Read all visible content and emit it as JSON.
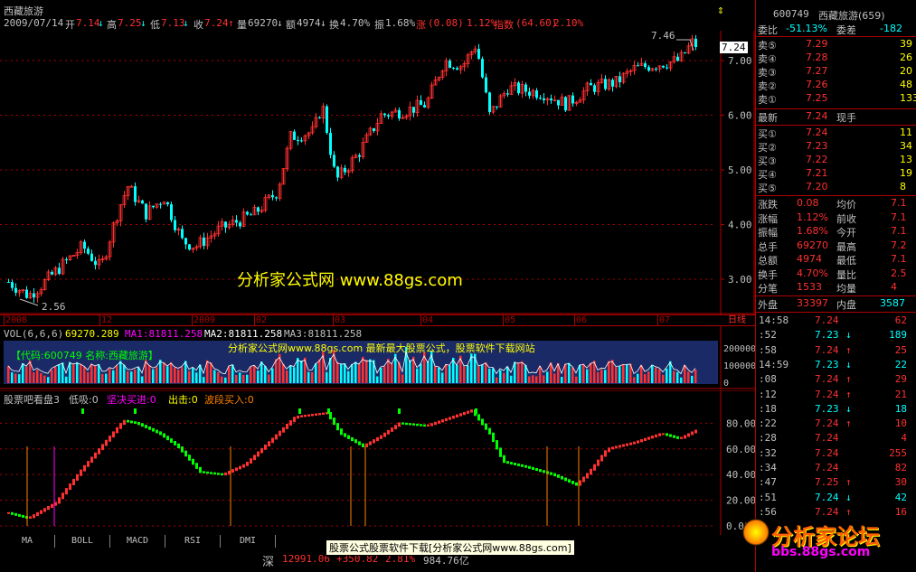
{
  "header": {
    "stock_name": "西藏旅游",
    "date": "2009/07/14",
    "open_label": "开",
    "open": "7.14",
    "high_label": "高",
    "high": "7.25",
    "low_label": "低",
    "low": "7.13",
    "close_label": "收",
    "close": "7.24",
    "volume_label": "量",
    "volume": "69270",
    "amount_label": "额",
    "amount": "4974",
    "turnover_label": "换",
    "turnover": "4.70%",
    "amplitude_label": "振",
    "amplitude": "1.68%",
    "change_label": "涨",
    "change": "(0.08)",
    "change_pct": "1.12%",
    "index_label": "指数",
    "index_val": "(64.60)",
    "index_pct": "2.10%"
  },
  "price_chart": {
    "high_marker": "7.46",
    "low_marker": "2.56",
    "current_price_tag": "7.24",
    "y_ticks": [
      "7.00",
      "6.00",
      "5.00",
      "4.00",
      "3.00"
    ],
    "x_labels": [
      "2008",
      "12",
      "2009",
      "02",
      "03",
      "04",
      "05",
      "06",
      "07",
      "日线"
    ],
    "watermark": "分析家公式网  www.88gs.com"
  },
  "volume_chart": {
    "legend_vol": "VOL(6,6,6)",
    "vol_val": "69270.289",
    "legend_ma1": "MA1:81811.258",
    "legend_ma2": "MA2:81811.258",
    "legend_ma3": "MA3:81811.258",
    "banner": "分析家公式网www.88gs.com 最新最大股票公式，股票软件下载网站",
    "code_box": "【代码:600749  名称:西藏旅游】",
    "y_ticks": [
      "200000",
      "100000",
      "0"
    ]
  },
  "indicator_chart": {
    "name": "股票吧看盘3",
    "low_buy": "低吸:0",
    "firm_buy": "坚决买进:0",
    "strike": "出击:0",
    "wave_buy": "波段买入:0",
    "y_ticks": [
      "80.00",
      "60.00",
      "40.00",
      "20.00",
      "0.00"
    ]
  },
  "tabs": [
    "MA",
    "BOLL",
    "MACD",
    "RSI",
    "DMI"
  ],
  "status": {
    "market": "深",
    "index_value": "12991.06",
    "index_change": "+350.82",
    "index_pct": "2.81%",
    "index_amount": "984.76亿",
    "tooltip": "股票公式股票软件下载[分析家公式网www.88gs.com]"
  },
  "quote_panel": {
    "code": "600749",
    "name": "西藏旅游(659)",
    "wei_bi_label": "委比",
    "wei_bi": "-51.13%",
    "wei_cha_label": "委差",
    "wei_cha": "-182",
    "sells": [
      {
        "label": "卖⑤",
        "price": "7.29",
        "vol": "39"
      },
      {
        "label": "卖④",
        "price": "7.28",
        "vol": "26"
      },
      {
        "label": "卖③",
        "price": "7.27",
        "vol": "20"
      },
      {
        "label": "卖②",
        "price": "7.26",
        "vol": "48"
      },
      {
        "label": "卖①",
        "price": "7.25",
        "vol": "133"
      }
    ],
    "last_label": "最新",
    "last": "7.24",
    "cur_hand_label": "现手",
    "buys": [
      {
        "label": "买①",
        "price": "7.24",
        "vol": "11"
      },
      {
        "label": "买②",
        "price": "7.23",
        "vol": "34"
      },
      {
        "label": "买③",
        "price": "7.22",
        "vol": "13"
      },
      {
        "label": "买④",
        "price": "7.21",
        "vol": "19"
      },
      {
        "label": "买⑤",
        "price": "7.20",
        "vol": "8"
      }
    ],
    "stats": [
      {
        "l1": "涨跌",
        "v1": "0.08",
        "l2": "均价",
        "v2": "7.1"
      },
      {
        "l1": "涨幅",
        "v1": "1.12%",
        "l2": "前收",
        "v2": "7.1"
      },
      {
        "l1": "振幅",
        "v1": "1.68%",
        "l2": "今开",
        "v2": "7.1"
      },
      {
        "l1": "总手",
        "v1": "69270",
        "l2": "最高",
        "v2": "7.2"
      },
      {
        "l1": "总额",
        "v1": "4974",
        "l2": "最低",
        "v2": "7.1"
      },
      {
        "l1": "换手",
        "v1": "4.70%",
        "l2": "量比",
        "v2": "2.5"
      },
      {
        "l1": "分笔",
        "v1": "1533",
        "l2": "均量",
        "v2": "4"
      }
    ],
    "outer_label": "外盘",
    "outer": "33397",
    "inner_label": "内盘",
    "inner": "3587",
    "ticks": [
      {
        "time": "14:58",
        "price": "7.24",
        "arrow": "",
        "vol": "62"
      },
      {
        "time": ":52",
        "price": "7.23",
        "arrow": "↓",
        "vol": "189"
      },
      {
        "time": ":58",
        "price": "7.24",
        "arrow": "↑",
        "vol": "25"
      },
      {
        "time": "14:59",
        "price": "7.23",
        "arrow": "↓",
        "vol": "22"
      },
      {
        "time": ":08",
        "price": "7.24",
        "arrow": "↑",
        "vol": "29"
      },
      {
        "time": ":12",
        "price": "7.24",
        "arrow": "↑",
        "vol": "21"
      },
      {
        "time": ":18",
        "price": "7.23",
        "arrow": "↓",
        "vol": "18"
      },
      {
        "time": ":22",
        "price": "7.24",
        "arrow": "↑",
        "vol": "10"
      },
      {
        "time": ":28",
        "price": "7.24",
        "arrow": "",
        "vol": "4"
      },
      {
        "time": ":32",
        "price": "7.24",
        "arrow": "",
        "vol": "255"
      },
      {
        "time": ":34",
        "price": "7.24",
        "arrow": "",
        "vol": "82"
      },
      {
        "time": ":47",
        "price": "7.25",
        "arrow": "↑",
        "vol": "30"
      },
      {
        "time": ":51",
        "price": "7.24",
        "arrow": "↓",
        "vol": "42"
      },
      {
        "time": ":56",
        "price": "7.24",
        "arrow": "↑",
        "vol": "16"
      }
    ],
    "forum_logo": "分析家论坛",
    "forum_url": "bbs.88gs.com"
  },
  "colors": {
    "up": "#ff3030",
    "down": "#00ffff",
    "grid": "#b00000",
    "label": "#c0c0c0",
    "yellow": "#ffff00"
  }
}
